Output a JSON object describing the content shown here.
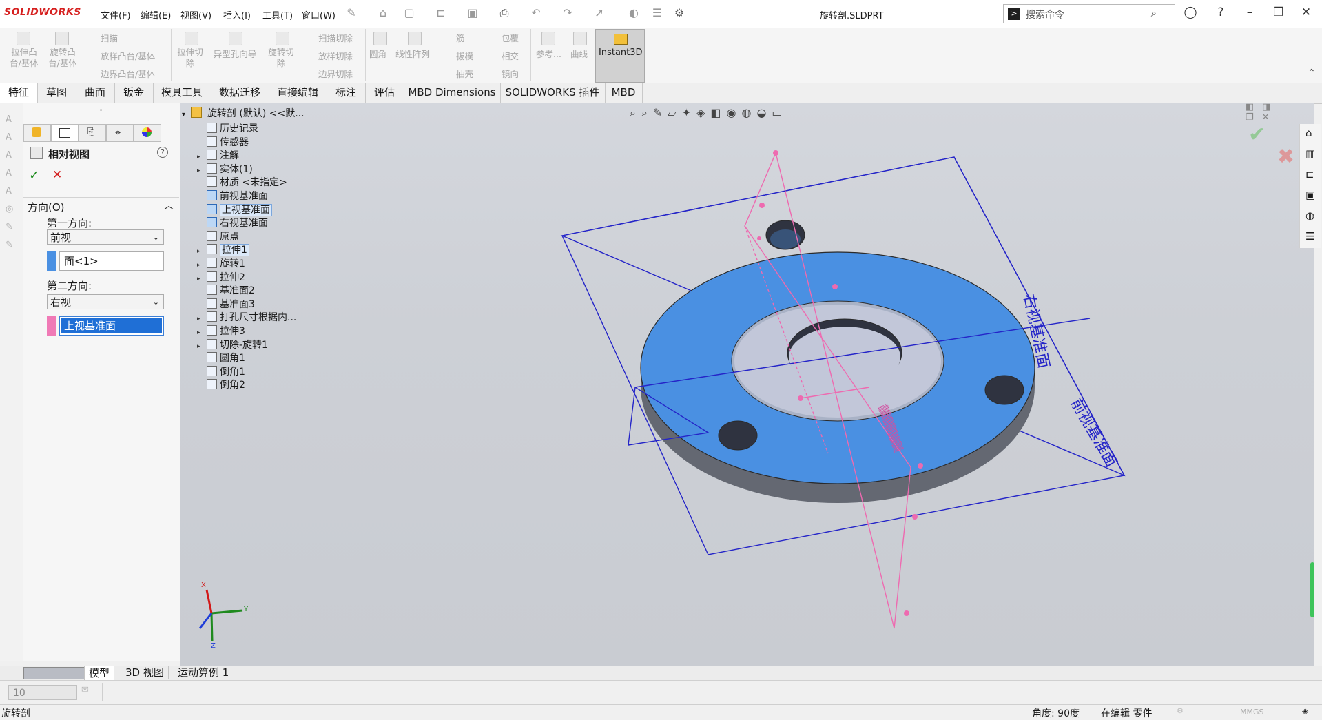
{
  "app": {
    "logo": "SOLIDWORKS",
    "document_title": "旋转剖.SLDPRT"
  },
  "menu": [
    "文件(F)",
    "编辑(E)",
    "视图(V)",
    "插入(I)",
    "工具(T)",
    "窗口(W)"
  ],
  "search": {
    "placeholder": "搜索命令"
  },
  "ribbon": {
    "extrude_boss": "拉伸凸台/基体",
    "revolve_boss": "旋转凸台/基体",
    "sweep": "扫描",
    "loft": "放样凸台/基体",
    "boundary": "边界凸台/基体",
    "extrude_cut": "拉伸切除",
    "hole_wizard": "异型孔向导",
    "revolve_cut": "旋转切除",
    "swept_cut": "扫描切除",
    "lofted_cut": "放样切除",
    "boundary_cut": "边界切除",
    "fillet": "圆角",
    "linear_pattern": "线性阵列",
    "rib": "筋",
    "draft": "拔模",
    "shell": "抽壳",
    "wrap": "包覆",
    "intersect": "相交",
    "mirror": "镜向",
    "reference": "参考...",
    "curves": "曲线",
    "instant3d": "Instant3D"
  },
  "tabs": [
    "特征",
    "草图",
    "曲面",
    "钣金",
    "模具工具",
    "数据迁移",
    "直接编辑",
    "标注",
    "评估",
    "MBD Dimensions",
    "SOLIDWORKS 插件",
    "MBD"
  ],
  "property_manager": {
    "title": "相对视图",
    "section": "方向(O)",
    "first_dir_label": "第一方向:",
    "first_dir_value": "前视",
    "first_face": "面<1>",
    "second_dir_label": "第二方向:",
    "second_dir_value": "右视",
    "second_face": "上视基准面",
    "colors": {
      "first": "#4a90e2",
      "second": "#f07ab6"
    }
  },
  "tree": {
    "root": "旋转剖 (默认) <<默...",
    "items": [
      "历史记录",
      "传感器",
      "注解",
      "实体(1)",
      "材质 <未指定>",
      "前视基准面",
      "上视基准面",
      "右视基准面",
      "原点",
      "拉伸1",
      "旋转1",
      "拉伸2",
      "基准面2",
      "基准面3",
      "打孔尺寸根据内...",
      "拉伸3",
      "切除-旋转1",
      "圆角1",
      "倒角1",
      "倒角2"
    ]
  },
  "viewport": {
    "plane_label_right": "右视基准面",
    "plane_label_front": "前视基准面",
    "triad": {
      "x": "X",
      "y": "Y",
      "z": "Z"
    },
    "colors": {
      "part": "#4a90e2",
      "plane": "#2424c8",
      "sketch": "#ee6ab0"
    }
  },
  "bottom_tabs": [
    "模型",
    "3D 视图",
    "运动算例 1"
  ],
  "status": {
    "left": "旋转剖",
    "angle": "角度: 90度",
    "mode": "在编辑 零件",
    "units": "MMGS",
    "zoom_value": "10"
  }
}
